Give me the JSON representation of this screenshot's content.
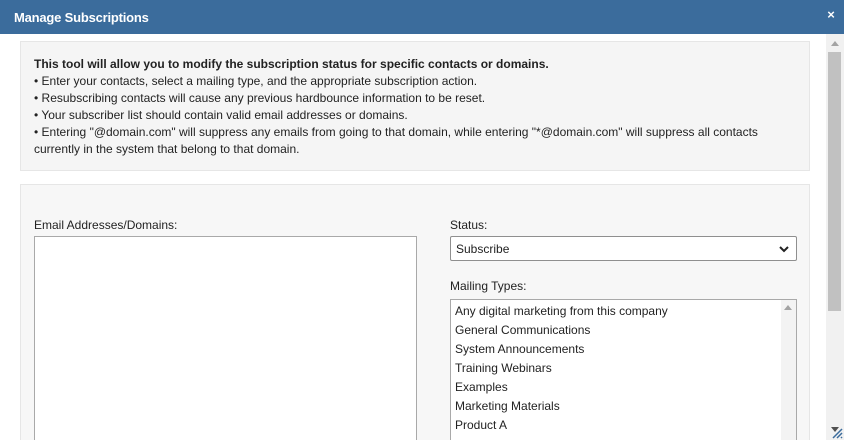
{
  "dialog": {
    "title": "Manage Subscriptions",
    "close_glyph": "×"
  },
  "info": {
    "lead": "This tool will allow you to modify the subscription status for specific contacts or domains.",
    "bullets": [
      "• Enter your contacts, select a mailing type, and the appropriate subscription action.",
      "• Resubscribing contacts will cause any previous hardbounce information to be reset.",
      "• Your subscriber list should contain valid email addresses or domains.",
      "• Entering \"@domain.com\" will suppress any emails from going to that domain, while entering \"*@domain.com\" will suppress all contacts currently in the system that belong to that domain."
    ]
  },
  "form": {
    "email_label": "Email Addresses/Domains:",
    "email_value": "",
    "status_label": "Status:",
    "status_value": "Subscribe",
    "mailing_types_label": "Mailing Types:",
    "mailing_types": [
      "Any digital marketing from this company",
      "General Communications",
      "System Announcements",
      "Training Webinars",
      "Examples",
      "Marketing Materials",
      "Product A"
    ]
  },
  "icons": {
    "close": "close-icon",
    "status_dropdown": "chevron-down-icon",
    "scroll_up": "scroll-up-arrow-icon",
    "scroll_down": "scroll-down-arrow-icon",
    "resize": "resize-grip-icon"
  },
  "colors": {
    "titlebar": "#3b6c9c",
    "panel_bg": "#f5f5f5"
  }
}
